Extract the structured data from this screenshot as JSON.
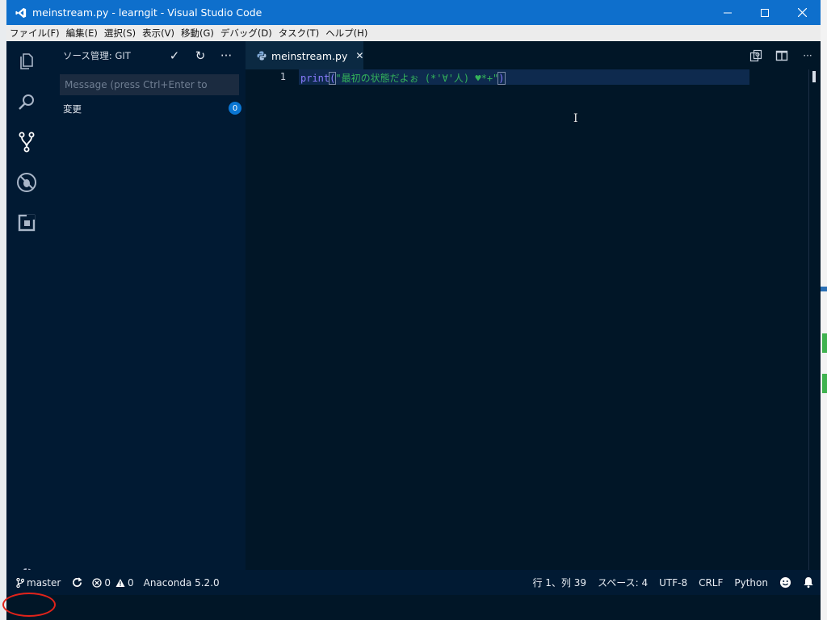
{
  "window": {
    "title": "meinstream.py - learngit - Visual Studio Code",
    "controls": [
      "minimize-icon",
      "maximize-icon",
      "close-icon"
    ]
  },
  "menu": [
    "ファイル(F)",
    "編集(E)",
    "選択(S)",
    "表示(V)",
    "移動(G)",
    "デバッグ(D)",
    "タスク(T)",
    "ヘルプ(H)"
  ],
  "activity_bar": [
    "explorer-icon",
    "search-icon",
    "source-control-icon",
    "debug-icon",
    "extensions-icon",
    "gear-icon"
  ],
  "sidebar": {
    "title": "ソース管理: GIT",
    "actions": [
      "commit-check-icon",
      "refresh-icon",
      "more-icon"
    ],
    "commit_placeholder": "Message (press Ctrl+Enter to",
    "changes_label": "変更",
    "changes_count": "0"
  },
  "editor": {
    "tab_label": "meinstream.py",
    "line_number": "1",
    "code": {
      "keyword": "print",
      "open_paren": "(",
      "string": "\"最初の状態だよぉ (*'∀'人) ♥*+\"",
      "close_paren": ")"
    },
    "actions": [
      "open-changes-icon",
      "split-editor-icon",
      "more-icon"
    ]
  },
  "status_bar": {
    "branch": "master",
    "errors": "0",
    "warnings": "0",
    "interpreter": "Anaconda 5.2.0",
    "position": "行 1、列 39",
    "indent": "スペース: 4",
    "encoding": "UTF-8",
    "eol": "CRLF",
    "language": "Python"
  },
  "colors": {
    "titlebar": "#0e6fcc",
    "background": "#011627",
    "sidebar": "#011a33",
    "keyword": "#8a7cff",
    "string": "#34b35a",
    "badge": "#0a76d3",
    "annotation": "#e2231a"
  }
}
